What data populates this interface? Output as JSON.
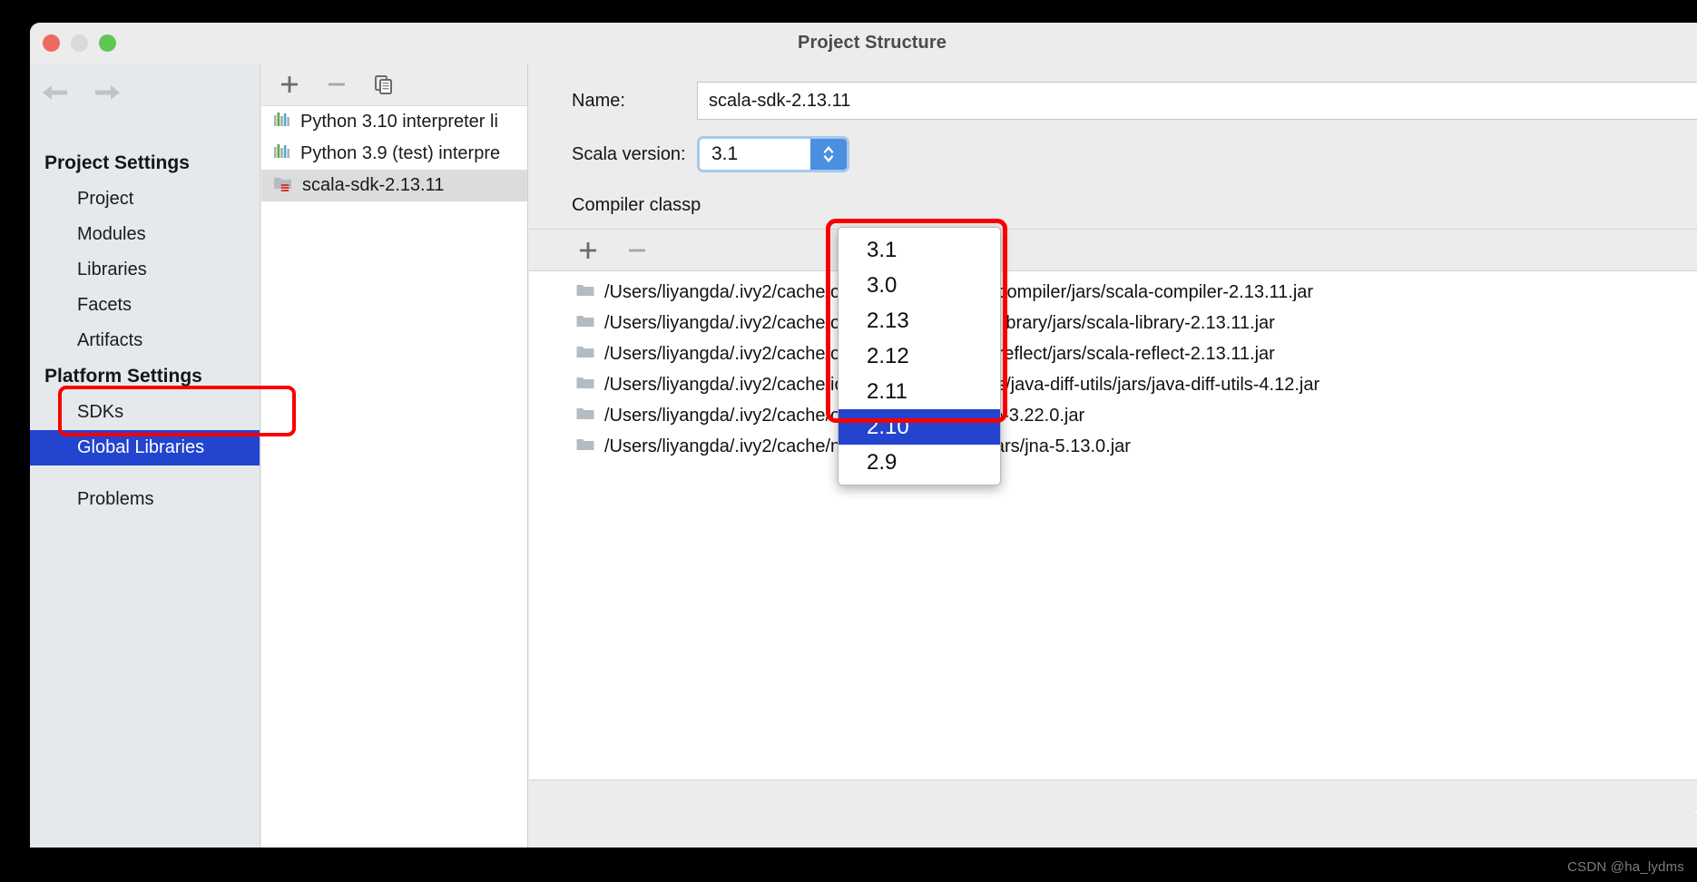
{
  "window": {
    "title": "Project Structure",
    "traffic_lights": [
      "close",
      "minimize",
      "zoom"
    ]
  },
  "sidebar": {
    "nav": {
      "back_icon": "arrow-left-icon",
      "forward_icon": "arrow-right-icon"
    },
    "groups": [
      {
        "label": "Project Settings",
        "items": [
          {
            "label": "Project",
            "selected": false
          },
          {
            "label": "Modules",
            "selected": false
          },
          {
            "label": "Libraries",
            "selected": false
          },
          {
            "label": "Facets",
            "selected": false
          },
          {
            "label": "Artifacts",
            "selected": false
          }
        ]
      },
      {
        "label": "Platform Settings",
        "items": [
          {
            "label": "SDKs",
            "selected": false
          },
          {
            "label": "Global Libraries",
            "selected": true
          }
        ]
      }
    ],
    "extra_items": [
      {
        "label": "Problems",
        "selected": false
      }
    ]
  },
  "library_list": {
    "toolbar": [
      {
        "name": "add",
        "glyph": "+"
      },
      {
        "name": "remove",
        "glyph": "−"
      },
      {
        "name": "copy",
        "glyph": "copy-icon"
      }
    ],
    "rows": [
      {
        "label": "Python 3.10 interpreter li",
        "icon": "python-library-icon",
        "selected": false
      },
      {
        "label": "Python 3.9 (test) interpre",
        "icon": "python-library-icon",
        "selected": false
      },
      {
        "label": "scala-sdk-2.13.11",
        "icon": "scala-sdk-icon",
        "selected": true
      }
    ]
  },
  "detail": {
    "name_label": "Name:",
    "name_value": "scala-sdk-2.13.11",
    "version_label": "Scala version:",
    "version_value": "3.1",
    "compiler_classpath_label": "Compiler classp",
    "classpath_toolbar": [
      {
        "name": "add",
        "glyph": "+"
      },
      {
        "name": "remove",
        "glyph": "−"
      }
    ],
    "classpath_rows": [
      "/Users/liyangda/.ivy2/cache/org.scala-lang/scala-compiler/jars/scala-compiler-2.13.11.jar",
      "/Users/liyangda/.ivy2/cache/org.scala-lang/scala-library/jars/scala-library-2.13.11.jar",
      "/Users/liyangda/.ivy2/cache/org.scala-lang/scala-reflect/jars/scala-reflect-2.13.11.jar",
      "/Users/liyangda/.ivy2/cache/io.github.java-diff-utils/java-diff-utils/jars/java-diff-utils-4.12.jar",
      "/Users/liyangda/.ivy2/cache/org.jline/jline/jars/jline-3.22.0.jar",
      "/Users/liyangda/.ivy2/cache/net.java.dev.jna/jna/jars/jna-5.13.0.jar"
    ]
  },
  "dropdown": {
    "open": true,
    "options": [
      "3.1",
      "3.0",
      "2.13",
      "2.12",
      "2.11",
      "2.10",
      "2.9"
    ],
    "highlighted": "2.10"
  },
  "annotations": {
    "highlight_color": "#f90000",
    "selection_color": "#2244cf",
    "boxes": [
      "global-libraries-sidebar-item",
      "scala-version-dropdown"
    ]
  },
  "watermark": "CSDN @ha_lydms"
}
